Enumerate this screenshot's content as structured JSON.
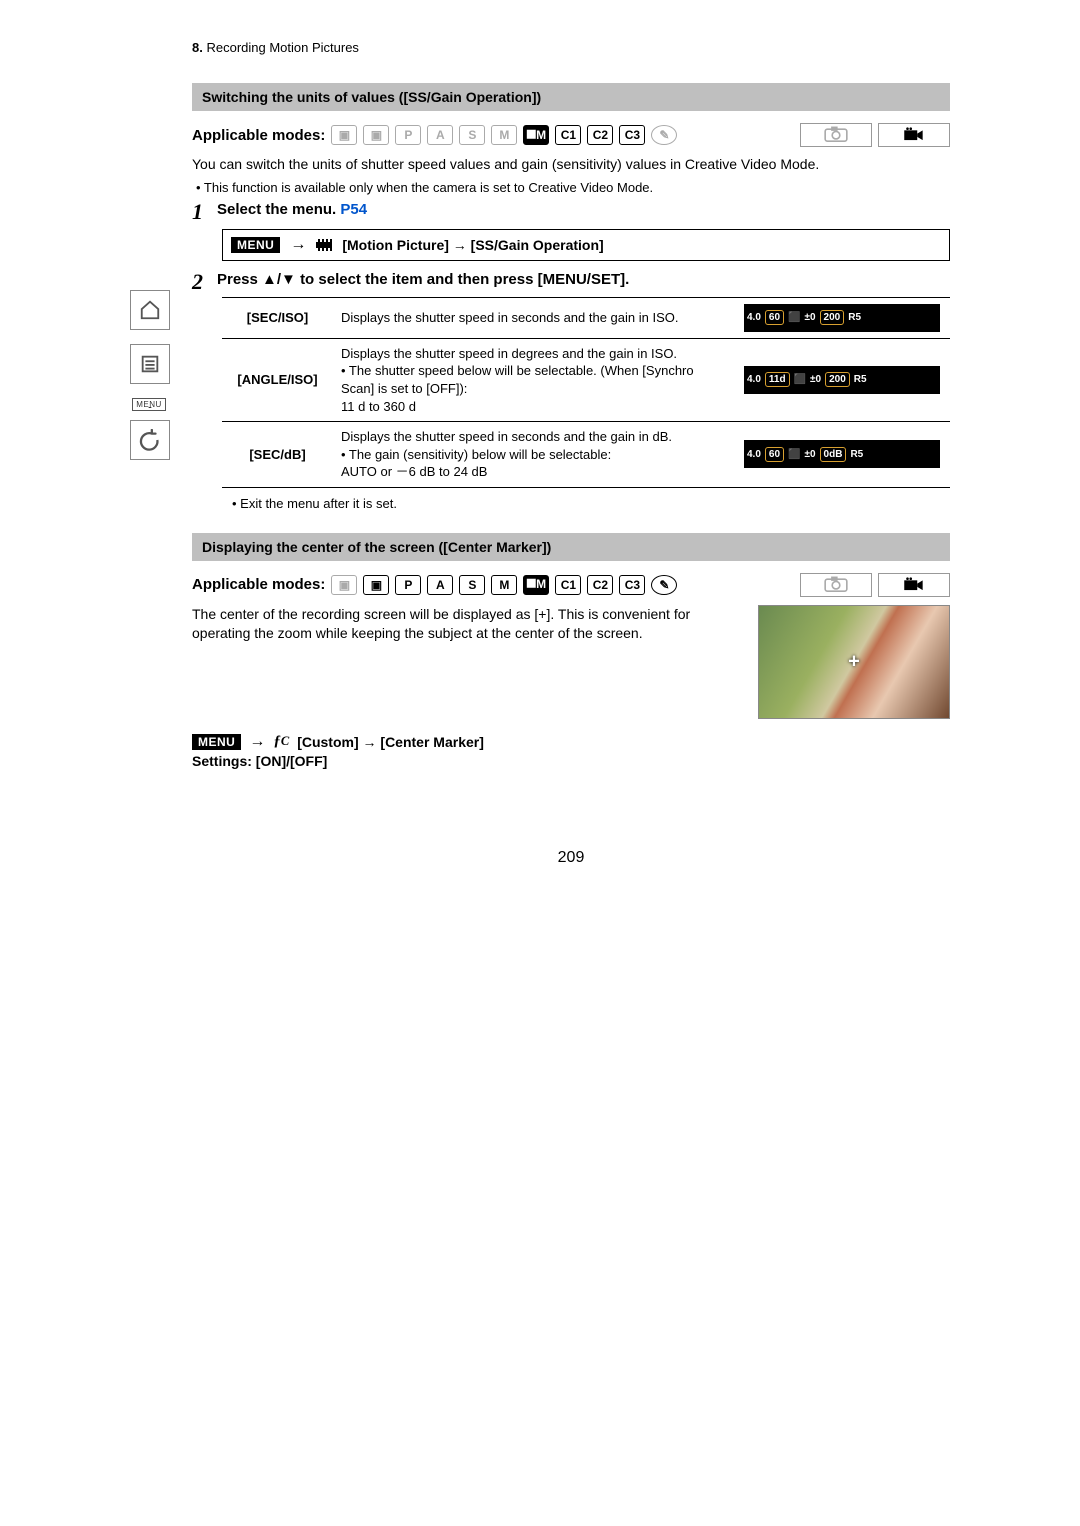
{
  "chapter": {
    "num": "8.",
    "title": "Recording Motion Pictures"
  },
  "sidebar": {
    "menu_label": "MENU"
  },
  "section1": {
    "title": "Switching the units of values ([SS/Gain Operation])",
    "modes_label": "Applicable modes:",
    "intro": "You can switch the units of shutter speed values and gain (sensitivity) values in Creative Video Mode.",
    "note": "• This function is available only when the camera is set to Creative Video Mode.",
    "step1_text": "Select the menu.",
    "step1_ref": "P54",
    "menu_path": "[Motion Picture] → [SS/Gain Operation]",
    "step2_text": "Press ▲/▼ to select the item and then press [MENU/SET].",
    "options": [
      {
        "name": "[SEC/ISO]",
        "desc": "Displays the shutter speed in seconds and the gain in ISO.",
        "chips": [
          "4.0",
          "60",
          "±0",
          "200",
          "R5"
        ]
      },
      {
        "name": "[ANGLE/ISO]",
        "desc": "Displays the shutter speed in degrees and the gain in ISO.\n• The shutter speed below will be selectable. (When [Synchro Scan] is set to [OFF]):\n11 d to 360 d",
        "chips": [
          "4.0",
          "11d",
          "±0",
          "200",
          "R5"
        ]
      },
      {
        "name": "[SEC/dB]",
        "desc": "Displays the shutter speed in seconds and the gain in dB.\n• The gain (sensitivity) below will be selectable:\nAUTO or －6 dB to 24 dB",
        "chips": [
          "4.0",
          "60",
          "±0",
          "0dB",
          "R5"
        ]
      }
    ],
    "exit_note": "• Exit the menu after it is set."
  },
  "section2": {
    "title": "Displaying the center of the screen ([Center Marker])",
    "modes_label": "Applicable modes:",
    "body": "The center of the recording screen will be displayed as [+]. This is convenient for operating the zoom while keeping the subject at the center of the screen.",
    "menu_path": "[Custom] → [Center Marker]",
    "settings": "Settings: [ON]/[OFF]"
  },
  "modes": [
    "iA",
    "iA+",
    "P",
    "A",
    "S",
    "M",
    "🎬M",
    "C1",
    "C2",
    "C3",
    "🎨"
  ],
  "page_number": "209"
}
